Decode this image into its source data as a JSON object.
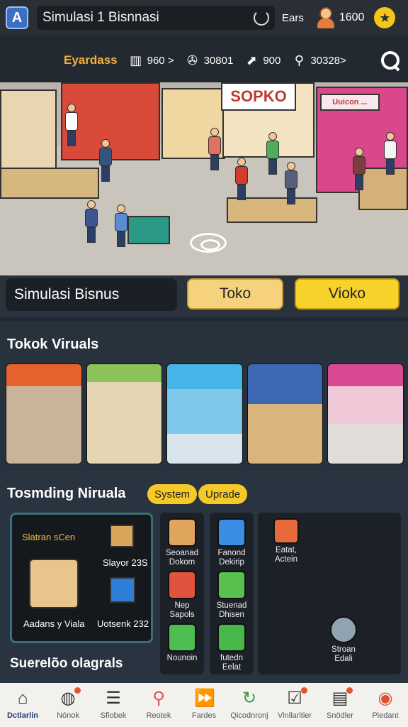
{
  "topbar": {
    "app_icon_letter": "A",
    "title": "Simulasi 1 Bisnnasi",
    "ears_label": "Ears",
    "coins": "1600"
  },
  "statbar": {
    "brand": "Eyardass",
    "stats": [
      {
        "icon": "bars-icon",
        "value": "960 >"
      },
      {
        "icon": "film-reel-icon",
        "value": "30801"
      },
      {
        "icon": "chart-arrow-icon",
        "value": "900"
      },
      {
        "icon": "key-icon",
        "value": "30328>"
      }
    ]
  },
  "hero": {
    "shop_sign_main": "SOPKO",
    "shop_sign_right": "Uuicon ..."
  },
  "actions": {
    "sim_label": "Simulasi Bisnus",
    "toko": "Toko",
    "vioko": "Vioko"
  },
  "section1": {
    "title": "Tokok Viruals",
    "thumbs": [
      "shop-1",
      "shop-2",
      "shop-3",
      "shop-4",
      "shop-5"
    ]
  },
  "section2": {
    "title": "Tosmding Niruala",
    "pill_system": "System",
    "pill_uprade": "Uprade",
    "big_card": {
      "top_left": "Slatran sCen",
      "top_right": "Slayor 23S",
      "bottom_left": "Aadans y Viala",
      "bottom_right": "Uotsenk 232"
    },
    "col1": [
      {
        "icon": "box-icon",
        "label": "Seoanad Dokom"
      },
      {
        "icon": "box-icon",
        "label": "Nep Sapols"
      },
      {
        "icon": "leaf-icon",
        "label": "Nounoin"
      }
    ],
    "col2": [
      {
        "icon": "pencil-icon",
        "label": "Fanond Dekirip"
      },
      {
        "icon": "pencil-icon",
        "label": "Stuenad Dhisen"
      },
      {
        "icon": "bag-icon",
        "label": "futedn Eelat"
      }
    ],
    "right_panel": {
      "top_label": "Eatat, Actein",
      "bottom_label": "Stroan Edali"
    },
    "footnote": "Suerelõo olagrals"
  },
  "bottomnav": [
    {
      "icon": "home-icon",
      "label": "Dctlarlin",
      "active": true,
      "badge": false
    },
    {
      "icon": "globe-icon",
      "label": "Nónok",
      "badge": true
    },
    {
      "icon": "list-icon",
      "label": "Sfiobek",
      "badge": false
    },
    {
      "icon": "search-icon",
      "label": "Reotek",
      "badge": false
    },
    {
      "icon": "forward-icon",
      "label": "Fardes",
      "badge": false
    },
    {
      "icon": "refresh-icon",
      "label": "Qicodnronj",
      "badge": false
    },
    {
      "icon": "inbox-icon",
      "label": "Vinilaritier",
      "badge": true
    },
    {
      "icon": "monitor-icon",
      "label": "Snödler",
      "badge": true
    },
    {
      "icon": "target-icon",
      "label": "Piedant",
      "badge": false
    }
  ],
  "colors": {
    "accent_yellow": "#f7d22b",
    "brand_orange": "#f4b23a",
    "background": "#1f2a36"
  }
}
